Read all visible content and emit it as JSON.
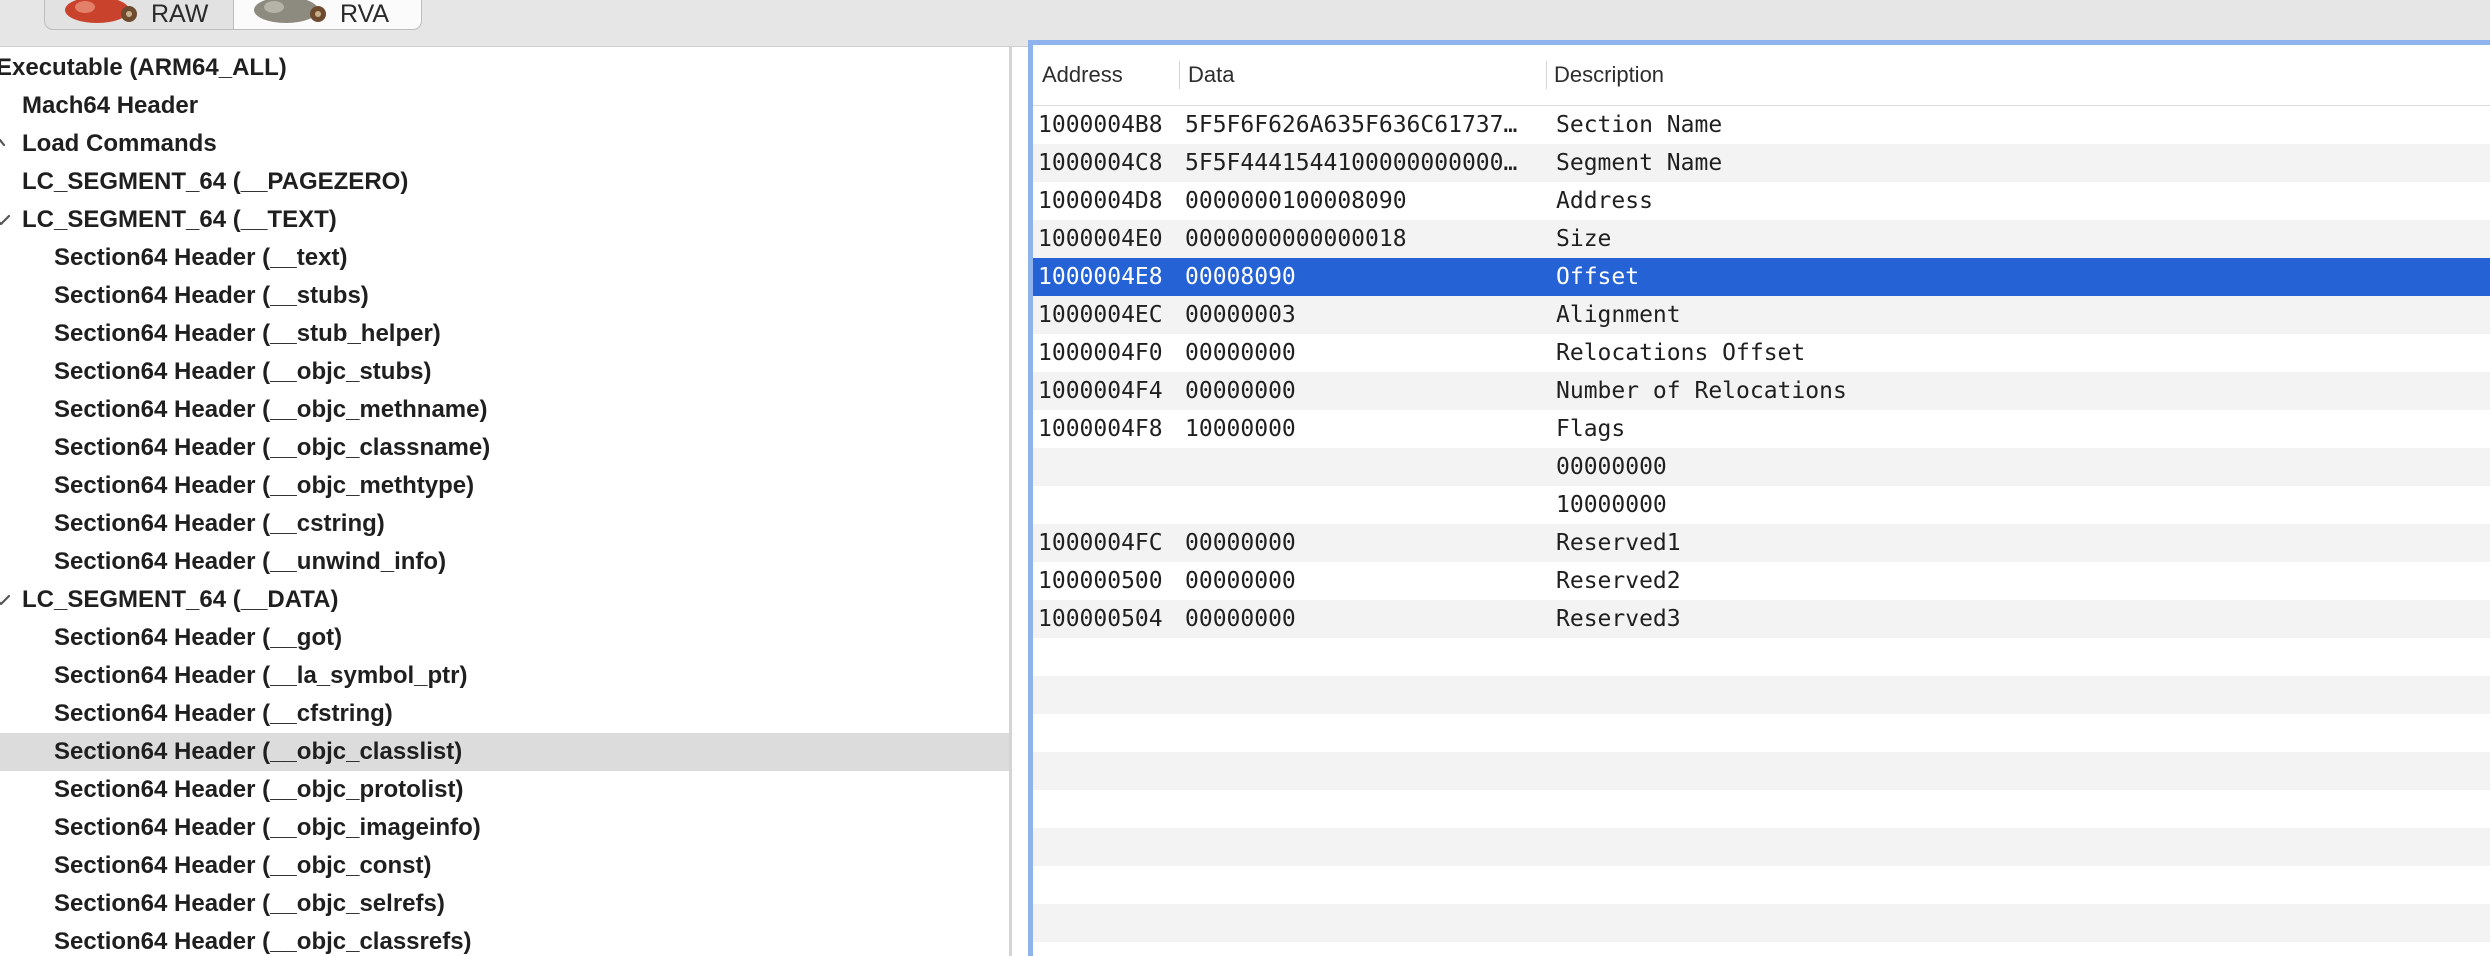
{
  "toolbar": {
    "raw_label": "RAW",
    "rva_label": "RVA",
    "raw_icon": "bundle-icon",
    "rva_icon": "bundle-icon"
  },
  "tree": [
    {
      "label": "Executable  (ARM64_ALL)",
      "level": 0,
      "chevron": "none"
    },
    {
      "label": "Mach64 Header",
      "level": 1,
      "chevron": "none"
    },
    {
      "label": "Load Commands",
      "level": 1,
      "chevron": "partial"
    },
    {
      "label": "LC_SEGMENT_64 (__PAGEZERO)",
      "level": 2,
      "chevron": "none"
    },
    {
      "label": "LC_SEGMENT_64 (__TEXT)",
      "level": 2,
      "chevron": "down"
    },
    {
      "label": "Section64 Header (__text)",
      "level": 3,
      "chevron": "none"
    },
    {
      "label": "Section64 Header (__stubs)",
      "level": 3,
      "chevron": "none"
    },
    {
      "label": "Section64 Header (__stub_helper)",
      "level": 3,
      "chevron": "none"
    },
    {
      "label": "Section64 Header (__objc_stubs)",
      "level": 3,
      "chevron": "none"
    },
    {
      "label": "Section64 Header (__objc_methname)",
      "level": 3,
      "chevron": "none"
    },
    {
      "label": "Section64 Header (__objc_classname)",
      "level": 3,
      "chevron": "none"
    },
    {
      "label": "Section64 Header (__objc_methtype)",
      "level": 3,
      "chevron": "none"
    },
    {
      "label": "Section64 Header (__cstring)",
      "level": 3,
      "chevron": "none"
    },
    {
      "label": "Section64 Header (__unwind_info)",
      "level": 3,
      "chevron": "none"
    },
    {
      "label": "LC_SEGMENT_64 (__DATA)",
      "level": 2,
      "chevron": "down"
    },
    {
      "label": "Section64 Header (__got)",
      "level": 3,
      "chevron": "none"
    },
    {
      "label": "Section64 Header (__la_symbol_ptr)",
      "level": 3,
      "chevron": "none"
    },
    {
      "label": "Section64 Header (__cfstring)",
      "level": 3,
      "chevron": "none"
    },
    {
      "label": "Section64 Header (__objc_classlist)",
      "level": 3,
      "chevron": "none",
      "selected": true
    },
    {
      "label": "Section64 Header (__objc_protolist)",
      "level": 3,
      "chevron": "none"
    },
    {
      "label": "Section64 Header (__objc_imageinfo)",
      "level": 3,
      "chevron": "none"
    },
    {
      "label": "Section64 Header (__objc_const)",
      "level": 3,
      "chevron": "none"
    },
    {
      "label": "Section64 Header (__objc_selrefs)",
      "level": 3,
      "chevron": "none"
    },
    {
      "label": "Section64 Header (__objc_classrefs)",
      "level": 3,
      "chevron": "none"
    }
  ],
  "table": {
    "headers": {
      "address": "Address",
      "data": "Data",
      "description": "Description"
    },
    "rows": [
      {
        "address": "1000004B8",
        "data": "5F5F6F626A635F636C61737…",
        "description": "Section Name"
      },
      {
        "address": "1000004C8",
        "data": "5F5F4441544100000000000…",
        "description": "Segment Name"
      },
      {
        "address": "1000004D8",
        "data": "0000000100008090",
        "description": "Address"
      },
      {
        "address": "1000004E0",
        "data": "0000000000000018",
        "description": "Size"
      },
      {
        "address": "1000004E8",
        "data": "00008090",
        "description": "Offset",
        "selected": true
      },
      {
        "address": "1000004EC",
        "data": "00000003",
        "description": "Alignment"
      },
      {
        "address": "1000004F0",
        "data": "00000000",
        "description": "Relocations Offset"
      },
      {
        "address": "1000004F4",
        "data": "00000000",
        "description": "Number of Relocations"
      },
      {
        "address": "1000004F8",
        "data": "10000000",
        "description": "Flags"
      },
      {
        "address": "",
        "data": "",
        "description": "00000000"
      },
      {
        "address": "",
        "data": "",
        "description": "10000000"
      },
      {
        "address": "1000004FC",
        "data": "00000000",
        "description": "Reserved1"
      },
      {
        "address": "100000500",
        "data": "00000000",
        "description": "Reserved2"
      },
      {
        "address": "100000504",
        "data": "00000000",
        "description": "Reserved3"
      }
    ]
  }
}
